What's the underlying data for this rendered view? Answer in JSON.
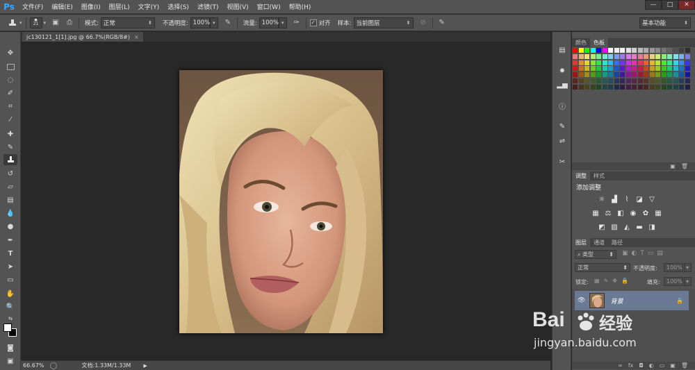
{
  "app": {
    "logo": "Ps"
  },
  "menu": [
    "文件(F)",
    "编辑(E)",
    "图像(I)",
    "图层(L)",
    "文字(Y)",
    "选择(S)",
    "滤镜(T)",
    "视图(V)",
    "窗口(W)",
    "帮助(H)"
  ],
  "window_controls": [
    "—",
    "□",
    "✕"
  ],
  "options": {
    "brush_size": "21",
    "mode_label": "模式:",
    "mode_value": "正常",
    "opacity_label": "不透明度:",
    "opacity_value": "100%",
    "flow_label": "流量:",
    "flow_value": "100%",
    "align_label": "对齐",
    "sample_label": "样本:",
    "sample_value": "当前图层",
    "workspace": "基本功能"
  },
  "document": {
    "tab_title": "jc130121_1[1].jpg @ 66.7%(RGB/8#)",
    "close": "×"
  },
  "status": {
    "zoom": "66.67%",
    "doc_info": "文档:1.33M/1.33M"
  },
  "panels": {
    "color_tabs": [
      "颜色",
      "色板"
    ],
    "adjust_tabs": [
      "调整",
      "样式"
    ],
    "adjust_title": "添加调整",
    "layers_tabs": [
      "图层",
      "通道",
      "路径"
    ],
    "layer_filter": "类型",
    "blend_mode": "正常",
    "opacity_label": "不透明度:",
    "opacity_value": "100%",
    "lock_label": "锁定:",
    "fill_label": "填充:",
    "fill_value": "100%",
    "layer_name": "背景"
  },
  "watermark": {
    "brand": "Bai",
    "brand2": "经验",
    "url": "jingyan.baidu.com"
  },
  "colors": {
    "chrome": "#535353",
    "dark": "#282828",
    "accent_logo": "#39a6ff",
    "layer_selected": "#6a7a94"
  }
}
